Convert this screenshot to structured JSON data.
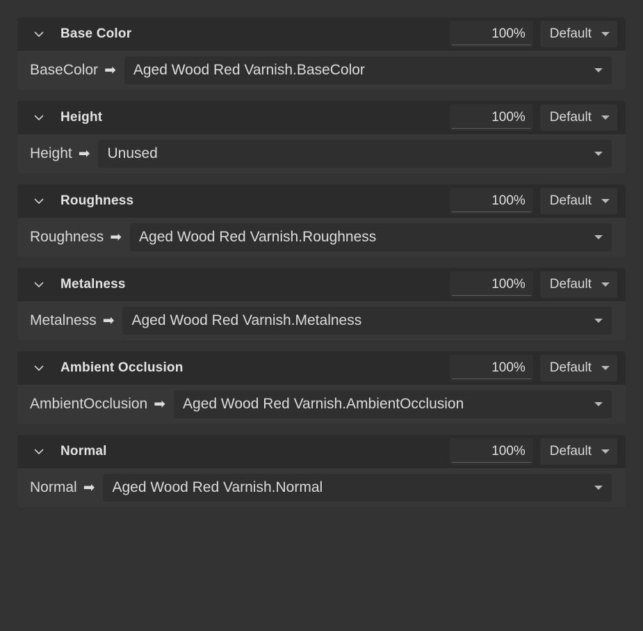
{
  "theme": {
    "page_bg": "#333333",
    "header_bg": "#2b2b2b",
    "body_bg": "#373737",
    "field_bg": "#2f2f2f",
    "text": "#dcdcdc",
    "accent_underline": "#5d5d5d"
  },
  "icons": {
    "chevron": "chevron-down-icon",
    "caret": "caret-down-icon",
    "arrow": "➡"
  },
  "sections": [
    {
      "title": "Base Color",
      "opacity": "100%",
      "blend_mode": "Default",
      "map_label": "BaseColor",
      "map_value": "Aged Wood Red Varnish.BaseColor"
    },
    {
      "title": "Height",
      "opacity": "100%",
      "blend_mode": "Default",
      "map_label": "Height",
      "map_value": "Unused"
    },
    {
      "title": "Roughness",
      "opacity": "100%",
      "blend_mode": "Default",
      "map_label": "Roughness",
      "map_value": "Aged Wood Red Varnish.Roughness"
    },
    {
      "title": "Metalness",
      "opacity": "100%",
      "blend_mode": "Default",
      "map_label": "Metalness",
      "map_value": "Aged Wood Red Varnish.Metalness"
    },
    {
      "title": "Ambient Occlusion",
      "opacity": "100%",
      "blend_mode": "Default",
      "map_label": "AmbientOcclusion",
      "map_value": "Aged Wood Red Varnish.AmbientOcclusion"
    },
    {
      "title": "Normal",
      "opacity": "100%",
      "blend_mode": "Default",
      "map_label": "Normal",
      "map_value": "Aged Wood Red Varnish.Normal"
    }
  ]
}
